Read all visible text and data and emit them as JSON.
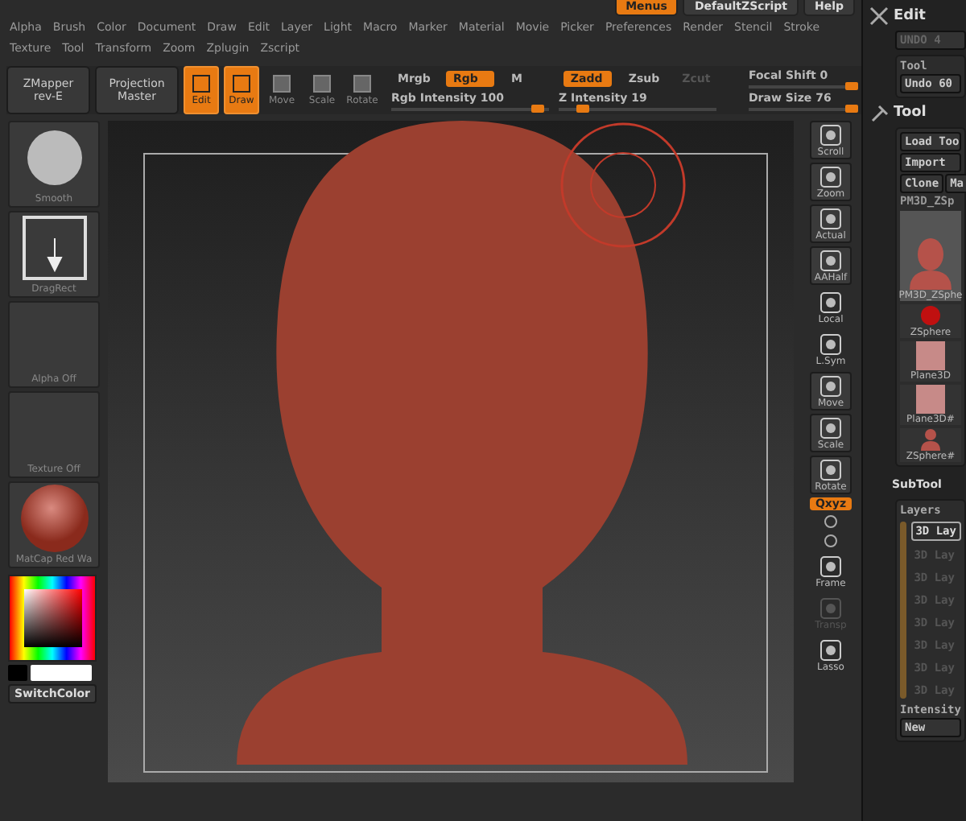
{
  "top_buttons": [
    {
      "label": "Menus",
      "selected": true
    },
    {
      "label": "DefaultZScript",
      "selected": false
    },
    {
      "label": "Help",
      "selected": false
    }
  ],
  "menus": [
    [
      "Alpha",
      "Brush",
      "Color",
      "Document",
      "Draw",
      "Edit",
      "Layer",
      "Light",
      "Macro",
      "Marker",
      "Material",
      "Movie",
      "Picker",
      "Preferences",
      "Render",
      "Stencil",
      "Stroke"
    ],
    [
      "Texture",
      "Tool",
      "Transform",
      "Zoom",
      "Zplugin",
      "Zscript"
    ]
  ],
  "toolbar": {
    "menus": [
      {
        "label": "ZMapper",
        "sub": "rev-E"
      },
      {
        "label": "Projection",
        "sub": "Master"
      }
    ],
    "modes": [
      {
        "label": "Edit",
        "selected": true
      },
      {
        "label": "Draw",
        "selected": true
      },
      {
        "label": "Move",
        "selected": false
      },
      {
        "label": "Scale",
        "selected": false
      },
      {
        "label": "Rotate",
        "selected": false
      }
    ],
    "rgb_toggles": [
      {
        "label": "Mrgb",
        "selected": false
      },
      {
        "label": "Rgb",
        "selected": true
      },
      {
        "label": "M",
        "selected": false
      }
    ],
    "z_toggles": [
      {
        "label": "Zadd",
        "selected": true,
        "disabled": false
      },
      {
        "label": "Zsub",
        "selected": false,
        "disabled": false
      },
      {
        "label": "Zcut",
        "selected": false,
        "disabled": true
      }
    ],
    "sliders": [
      {
        "label": "Rgb Intensity",
        "reading": "100",
        "level": 0.93
      },
      {
        "label": "Z Intensity",
        "reading": "19",
        "level": 0.15
      },
      {
        "label": "Focal Shift",
        "reading": "0",
        "level": 0.97
      },
      {
        "label": "Draw Size",
        "reading": "76",
        "level": 0.97
      }
    ]
  },
  "left_shelf": {
    "slots": [
      {
        "kind": "brush",
        "label": "Smooth"
      },
      {
        "kind": "stroke",
        "label": "DragRect"
      },
      {
        "kind": "empty",
        "label": "Alpha Off"
      },
      {
        "kind": "empty",
        "label": "Texture Off"
      },
      {
        "kind": "material",
        "label": "MatCap Red Wa"
      }
    ],
    "switch_button": "SwitchColor"
  },
  "right_shelf": [
    {
      "kind": "button",
      "label": "Scroll",
      "disabled": false
    },
    {
      "kind": "button",
      "label": "Zoom",
      "disabled": false
    },
    {
      "kind": "button",
      "label": "Actual",
      "disabled": false
    },
    {
      "kind": "button",
      "label": "AAHalf",
      "disabled": false
    },
    {
      "kind": "plain",
      "label": "Local",
      "disabled": false
    },
    {
      "kind": "plain",
      "label": "L.Sym",
      "disabled": false
    },
    {
      "kind": "button",
      "label": "Move",
      "disabled": false
    },
    {
      "kind": "button",
      "label": "Scale",
      "disabled": false
    },
    {
      "kind": "button",
      "label": "Rotate",
      "disabled": false
    },
    {
      "kind": "toggle",
      "label": "Qxyz",
      "selected": true,
      "disabled": false
    },
    {
      "kind": "icon",
      "disabled": false
    },
    {
      "kind": "icon",
      "disabled": false
    },
    {
      "kind": "plain",
      "label": "Frame",
      "disabled": false
    },
    {
      "kind": "plain",
      "label": "Transp",
      "disabled": true
    },
    {
      "kind": "plain",
      "label": "Lasso",
      "disabled": false
    }
  ],
  "right_panel": {
    "edit_title": "Edit",
    "undo_button": "UNDO 4",
    "tool_sub_title": "Tool",
    "tool_undo": "Undo 60",
    "tool_title": "Tool",
    "buttons": [
      "Load Too",
      "Import"
    ],
    "row_buttons": [
      "Clone",
      "Ma"
    ],
    "current_tool": "PM3D_ZSp",
    "thumbnails": [
      {
        "kind": "bust",
        "label": "PM3D_ZSphe"
      },
      {
        "kind": "sphere",
        "label": "ZSphere"
      },
      {
        "kind": "plane",
        "label": "Plane3D"
      },
      {
        "kind": "plane",
        "label": "Plane3D#"
      },
      {
        "kind": "smallbust",
        "label": "ZSphere#"
      }
    ],
    "subtool_title": "SubTool",
    "layers_title": "Layers",
    "layers": [
      {
        "label": "3D Lay",
        "selected": true,
        "disabled": false
      },
      {
        "label": "3D Lay",
        "selected": false,
        "disabled": true
      },
      {
        "label": "3D Lay",
        "selected": false,
        "disabled": true
      },
      {
        "label": "3D Lay",
        "selected": false,
        "disabled": true
      },
      {
        "label": "3D Lay",
        "selected": false,
        "disabled": true
      },
      {
        "label": "3D Lay",
        "selected": false,
        "disabled": true
      },
      {
        "label": "3D Lay",
        "selected": false,
        "disabled": true
      },
      {
        "label": "3D Lay",
        "selected": false,
        "disabled": true
      }
    ],
    "intensity_label": "Intensity",
    "new_button": "New"
  }
}
